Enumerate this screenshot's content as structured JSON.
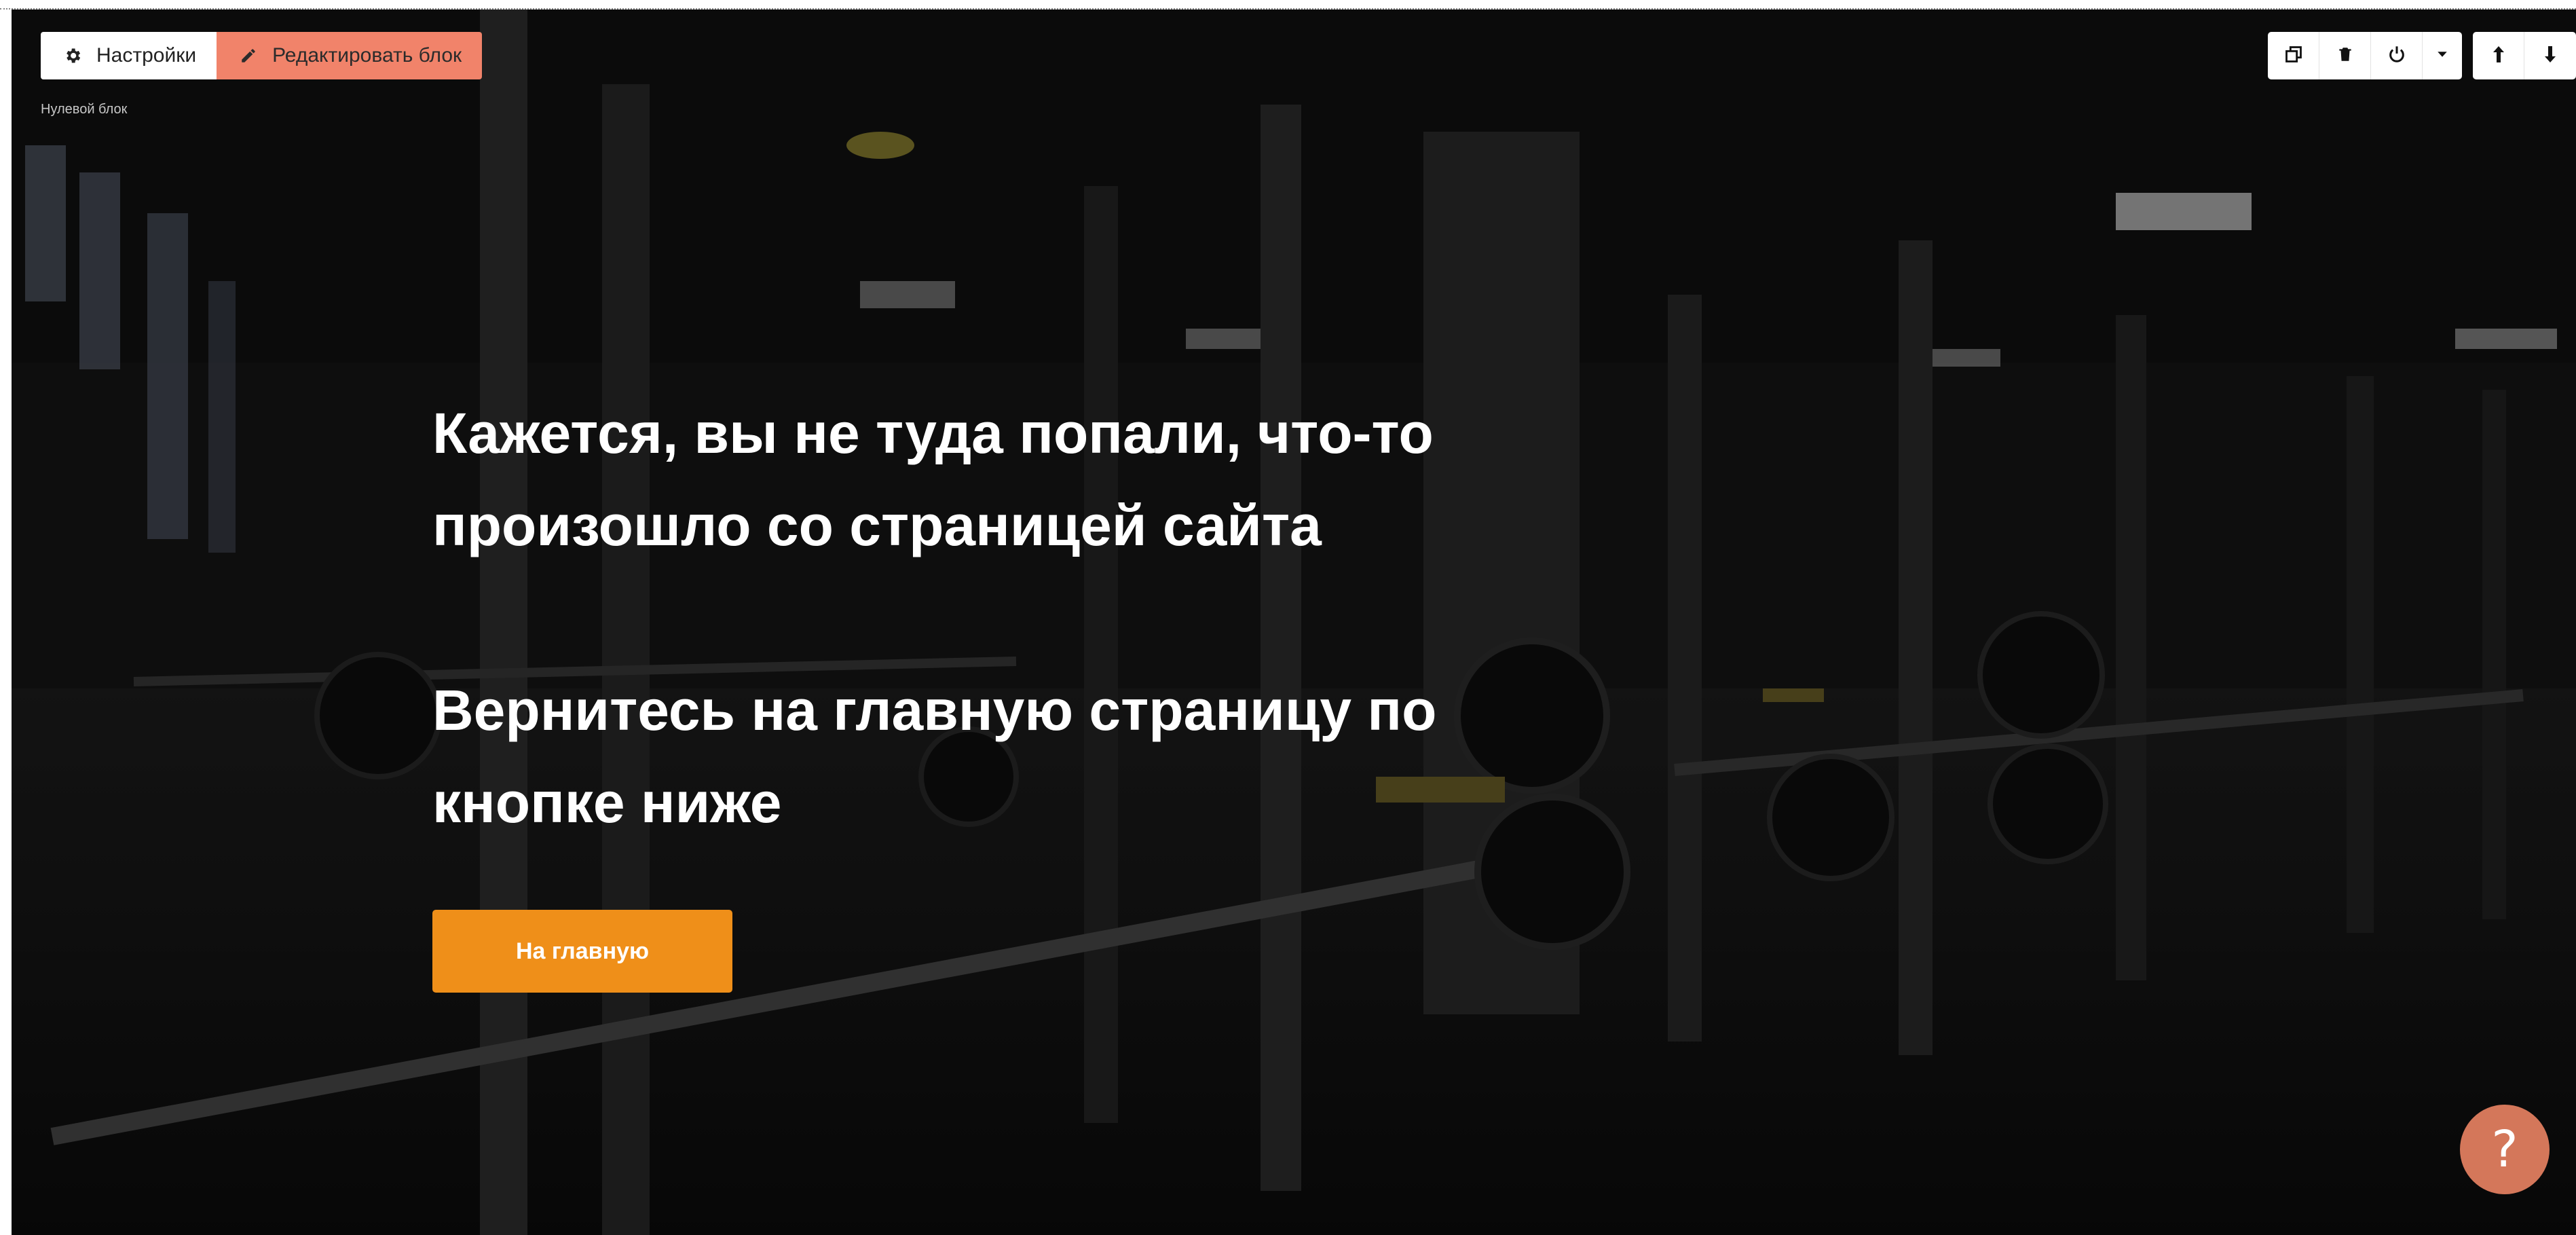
{
  "toolbar": {
    "settings_label": "Настройки",
    "edit_label": "Редактировать блок",
    "settings_icon": "gear-icon",
    "edit_icon": "pencil-icon",
    "block_label": "Нулевой блок"
  },
  "block_actions": [
    {
      "name": "duplicate-button",
      "icon": "duplicate-icon"
    },
    {
      "name": "delete-button",
      "icon": "trash-icon"
    },
    {
      "name": "power-button",
      "icon": "power-icon"
    },
    {
      "name": "more-dropdown-button",
      "icon": "chevron-down-icon"
    },
    {
      "name": "move-up-button",
      "icon": "arrow-up-icon"
    },
    {
      "name": "move-down-button",
      "icon": "arrow-down-icon"
    }
  ],
  "hero": {
    "line1": "Кажется, вы не туда попали, что-то",
    "line2": "произошло со страницей сайта",
    "line3": "Вернитесь на главную страницу по",
    "line4": "кнопке ниже"
  },
  "cta": {
    "label": "На главную"
  },
  "help": {
    "label": "?"
  },
  "colors": {
    "cta": "#ef8f19",
    "edit_button": "#f1836a",
    "help_button": "#d4775a",
    "text": "#ffffff"
  }
}
